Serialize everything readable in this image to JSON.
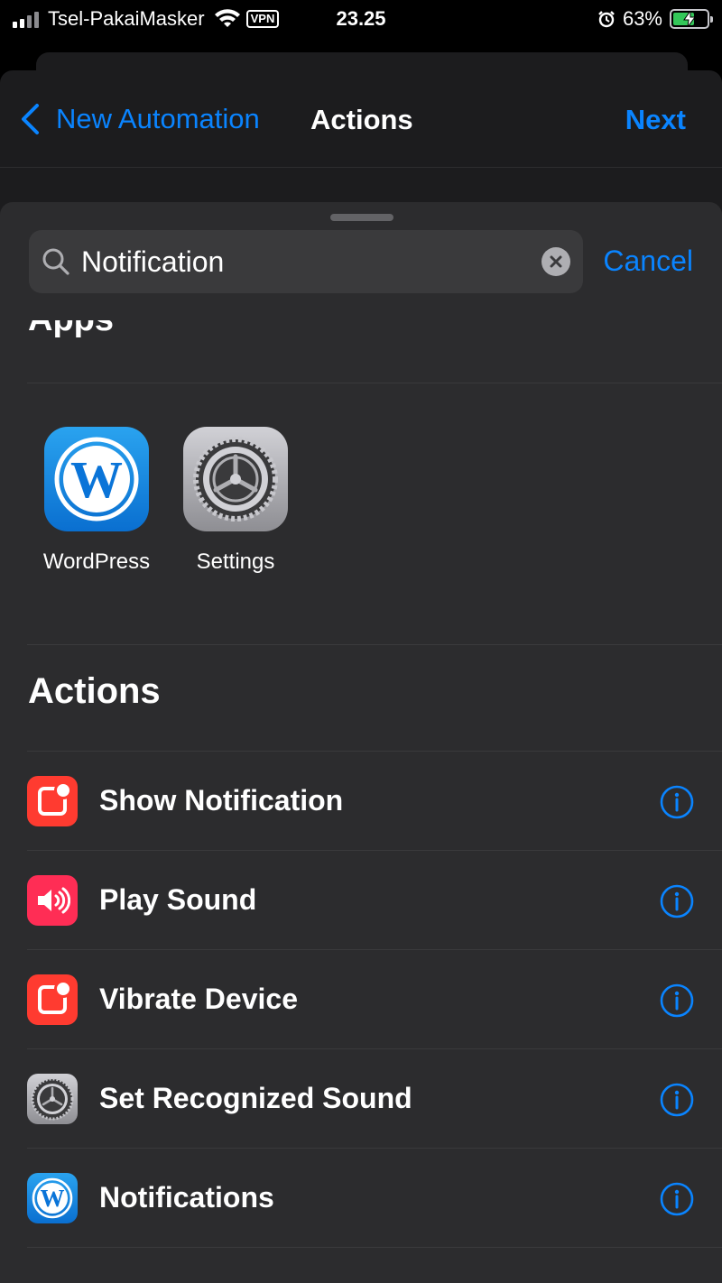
{
  "status_bar": {
    "carrier": "Tsel-PakaiMasker",
    "vpn": "VPN",
    "time": "23.25",
    "battery_percent": "63%",
    "battery_level": 0.63,
    "signal_bars": 2
  },
  "nav": {
    "back_label": "New Automation",
    "title": "Actions",
    "next_label": "Next"
  },
  "search": {
    "value": "Notification",
    "cancel_label": "Cancel"
  },
  "apps_section": {
    "heading": "Apps",
    "apps": [
      {
        "label": "WordPress",
        "icon": "wordpress-icon"
      },
      {
        "label": "Settings",
        "icon": "settings-gear-icon"
      }
    ]
  },
  "actions_section": {
    "heading": "Actions",
    "items": [
      {
        "label": "Show Notification",
        "icon": "notification-icon",
        "color": "#ff3b30"
      },
      {
        "label": "Play Sound",
        "icon": "speaker-icon",
        "color": "#ff2d55"
      },
      {
        "label": "Vibrate Device",
        "icon": "notification-icon",
        "color": "#ff3b30"
      },
      {
        "label": "Set Recognized Sound",
        "icon": "settings-gear-icon",
        "color": "#8e8e93"
      },
      {
        "label": "Notifications",
        "icon": "wordpress-icon",
        "color": "#0a84ff"
      }
    ]
  },
  "colors": {
    "accent": "#0a84ff",
    "sheet_bg": "#2c2c2e",
    "nav_bg": "#1c1c1e"
  }
}
